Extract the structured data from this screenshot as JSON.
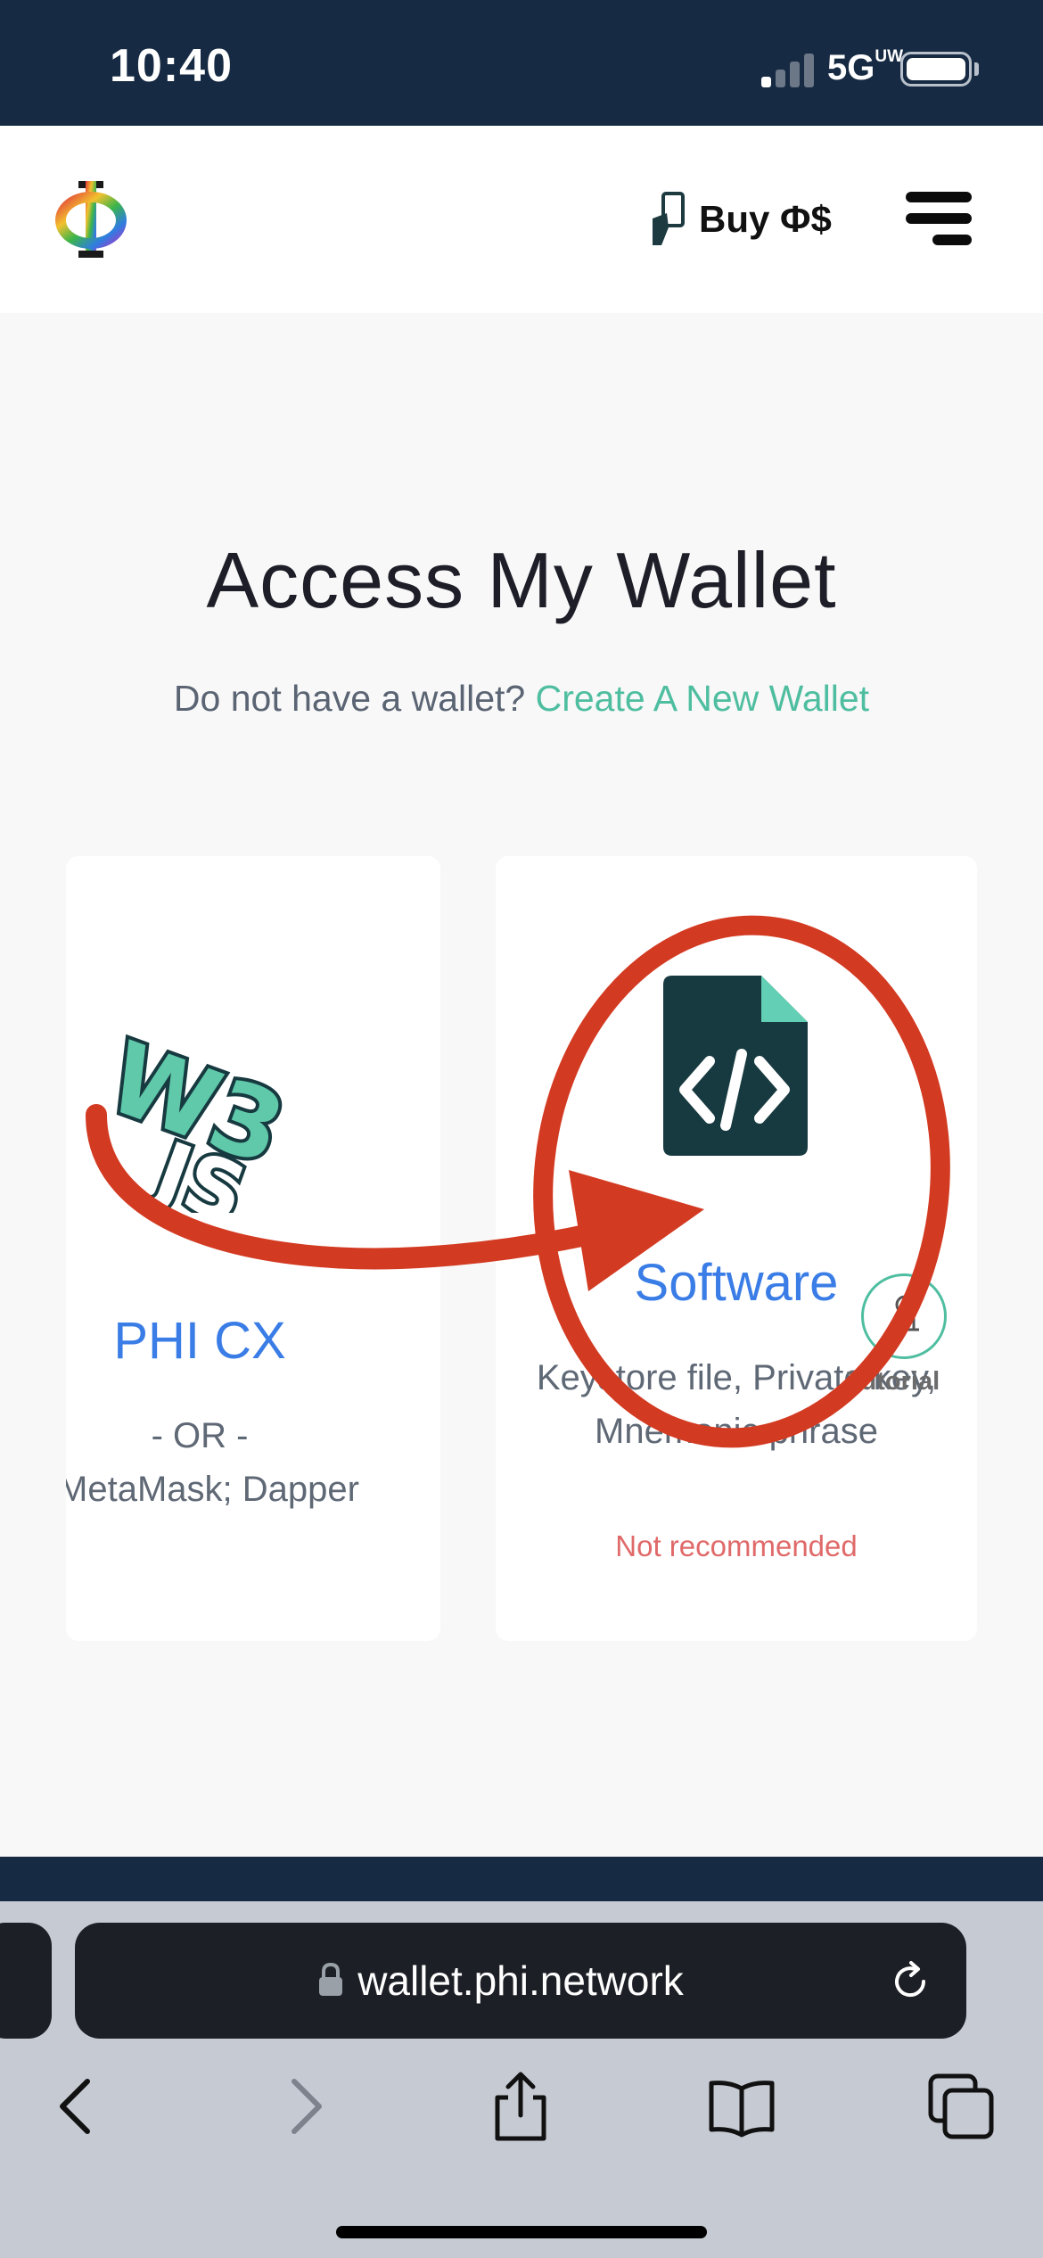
{
  "status_bar": {
    "time": "10:40",
    "network": "5G",
    "network_sup": "UW"
  },
  "header": {
    "logo_icon": "phi-logo-icon",
    "buy_label": "Buy Φ$",
    "buy_icon": "card-hand-icon",
    "menu_icon": "hamburger-menu-icon"
  },
  "main": {
    "title": "Access My Wallet",
    "subtitle_prefix": "Do not have a wallet? ",
    "create_link": "Create A New Wallet",
    "cards": [
      {
        "id": "phi-cx",
        "icon": "w3js-icon",
        "title": "PHI CX",
        "line1": "- OR -",
        "line2": "MetaMask; Dapper"
      },
      {
        "id": "software",
        "icon": "code-file-icon",
        "title": "Software",
        "description": "Keystore file, Private key, Mnemonic phrase",
        "warning": "Not recommended"
      }
    ],
    "tutorial_label": "Tutorial"
  },
  "annotation": {
    "color": "#d33a22",
    "shapes": [
      "arrow",
      "ellipse"
    ]
  },
  "browser": {
    "url": "wallet.phi.network",
    "icons": [
      "back-icon",
      "forward-icon",
      "share-icon",
      "bookmarks-icon",
      "tabs-icon"
    ]
  },
  "colors": {
    "navy": "#162a43",
    "accent_green": "#4fbea0",
    "link_blue": "#3a7de6",
    "warning_red": "#e06a6a"
  }
}
